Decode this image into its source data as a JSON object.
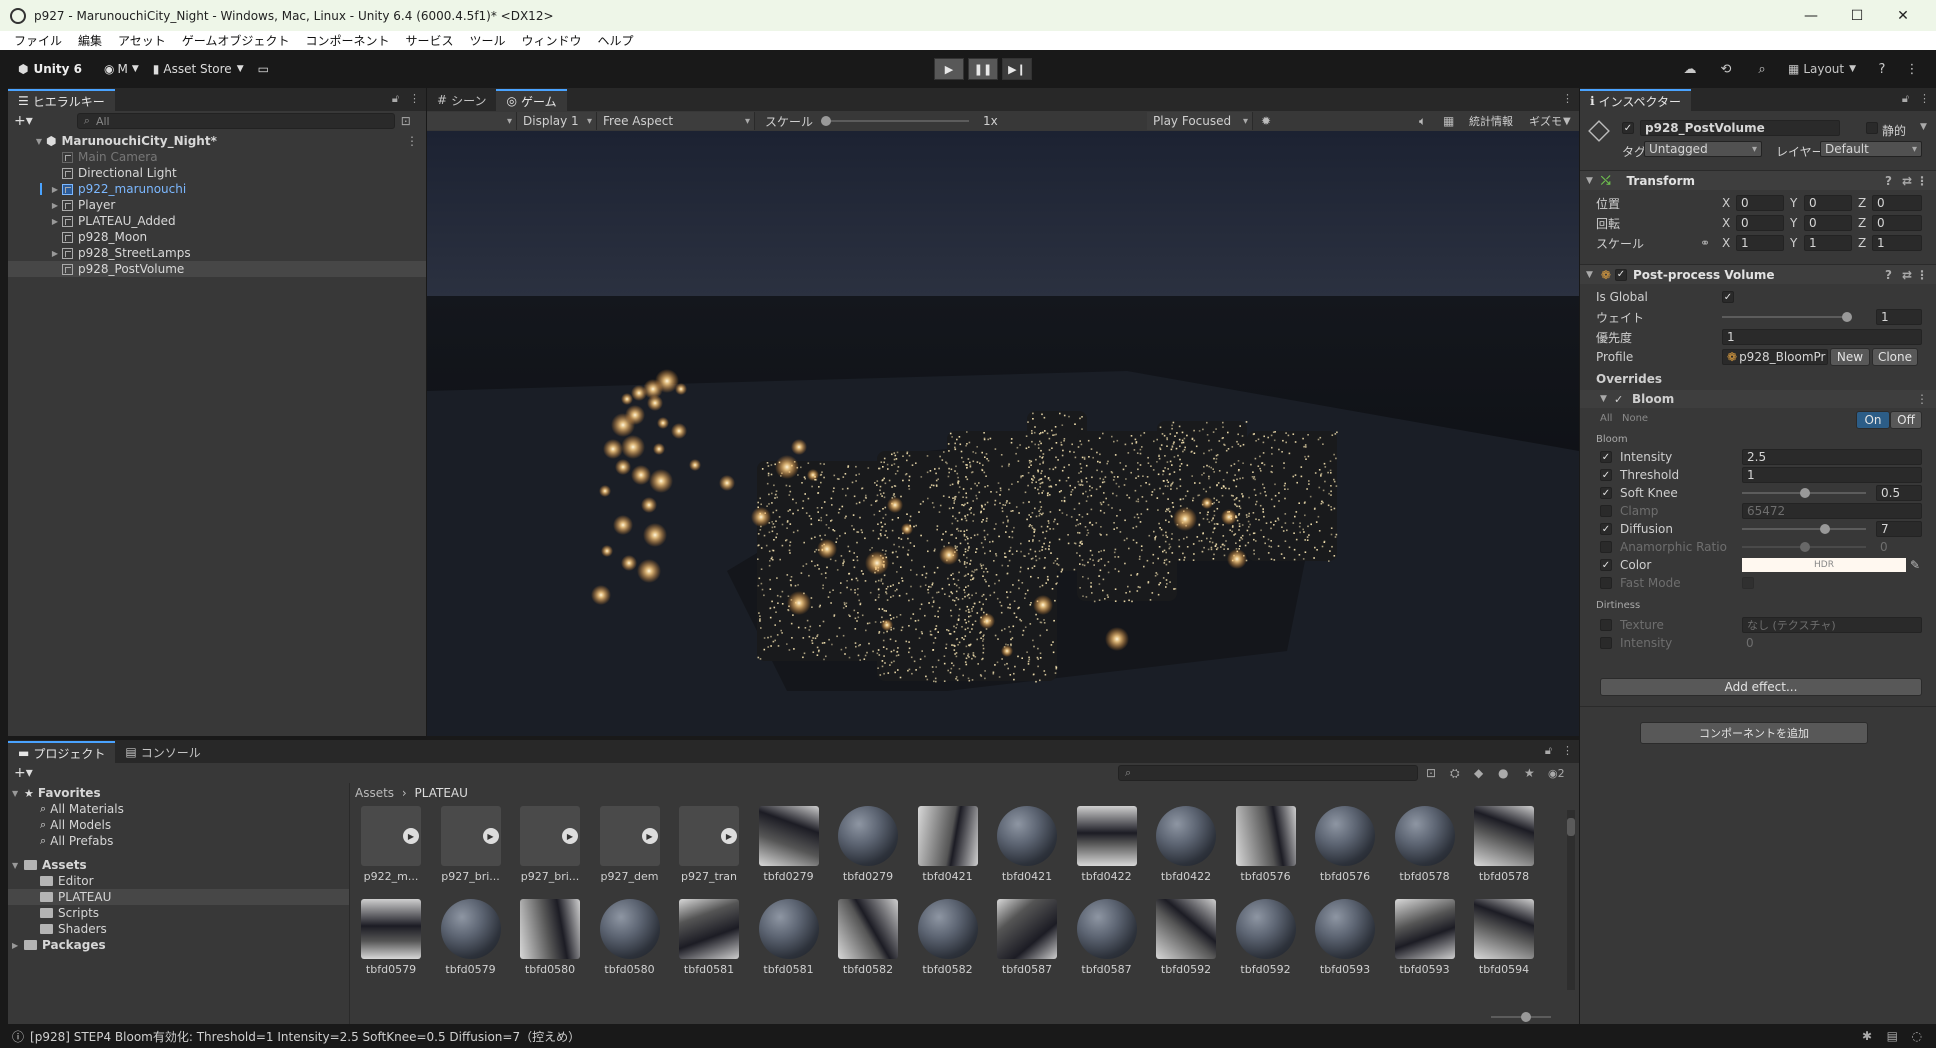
{
  "window": {
    "title": "p927 - MarunouchiCity_Night - Windows, Mac, Linux - Unity 6.4 (6000.4.5f1)* <DX12>",
    "minimize": "—",
    "maximize": "☐",
    "close": "✕"
  },
  "menu": [
    "ファイル",
    "編集",
    "アセット",
    "ゲームオブジェクト",
    "コンポーネント",
    "サービス",
    "ツール",
    "ウィンドウ",
    "ヘルプ"
  ],
  "toolbar": {
    "unity": "Unity 6",
    "account": "M",
    "asset_store": "Asset Store",
    "layout": "Layout"
  },
  "hierarchy": {
    "tab": "ヒエラルキー",
    "search_placeholder": "All",
    "scene": "MarunouchiCity_Night*",
    "items": [
      {
        "label": "Main Camera",
        "state": "dim",
        "expand": ""
      },
      {
        "label": "Directional Light",
        "state": "normal",
        "expand": ""
      },
      {
        "label": "p922_marunouchi",
        "state": "blue",
        "expand": "▶"
      },
      {
        "label": "Player",
        "state": "normal",
        "expand": "▶"
      },
      {
        "label": "PLATEAU_Added",
        "state": "normal",
        "expand": "▶"
      },
      {
        "label": "p928_Moon",
        "state": "normal",
        "expand": ""
      },
      {
        "label": "p928_StreetLamps",
        "state": "normal",
        "expand": "▶"
      },
      {
        "label": "p928_PostVolume",
        "state": "selected",
        "expand": ""
      }
    ]
  },
  "game": {
    "tab_scene": "シーン",
    "tab_game": "ゲーム",
    "display": "Display 1",
    "aspect": "Free Aspect",
    "scale_label": "スケール",
    "scale_value": "1x",
    "play_mode": "Play Focused",
    "stats": "統計情報",
    "gizmos": "ギズモ"
  },
  "inspector": {
    "tab": "インスペクター",
    "object_name": "p928_PostVolume",
    "static_label": "静的",
    "tag_label": "タグ",
    "tag": "Untagged",
    "layer_label": "レイヤー",
    "layer": "Default",
    "transform": {
      "title": "Transform",
      "rows": [
        {
          "label": "位置",
          "x": "0",
          "y": "0",
          "z": "0"
        },
        {
          "label": "回転",
          "x": "0",
          "y": "0",
          "z": "0"
        },
        {
          "label": "スケール",
          "x": "1",
          "y": "1",
          "z": "1"
        }
      ]
    },
    "ppv": {
      "title": "Post-process Volume",
      "is_global_label": "Is Global",
      "weight_label": "ウェイト",
      "weight": "1",
      "priority_label": "優先度",
      "priority": "1",
      "profile_label": "Profile",
      "profile": "p928_BloomPr",
      "new_btn": "New",
      "clone_btn": "Clone",
      "overrides": "Overrides",
      "bloom": "Bloom",
      "all": "All",
      "none": "None",
      "on": "On",
      "off": "Off",
      "bloom_section": "Bloom",
      "intensity_label": "Intensity",
      "intensity": "2.5",
      "threshold_label": "Threshold",
      "threshold": "1",
      "soft_knee_label": "Soft Knee",
      "soft_knee": "0.5",
      "clamp_label": "Clamp",
      "clamp": "65472",
      "diffusion_label": "Diffusion",
      "diffusion": "7",
      "anamorphic_label": "Anamorphic Ratio",
      "anamorphic": "0",
      "color_label": "Color",
      "color_hdr": "HDR",
      "fast_mode_label": "Fast Mode",
      "dirtiness": "Dirtiness",
      "texture_label": "Texture",
      "texture": "なし (テクスチャ)",
      "dirt_intensity_label": "Intensity",
      "dirt_intensity": "0",
      "add_effect": "Add effect...",
      "add_component": "コンポーネントを追加"
    }
  },
  "project": {
    "tab_project": "プロジェクト",
    "tab_console": "コンソール",
    "hidden_count": "2",
    "favorites": "Favorites",
    "fav_items": [
      "All Materials",
      "All Models",
      "All Prefabs"
    ],
    "assets": "Assets",
    "asset_folders": [
      "Editor",
      "PLATEAU",
      "Scripts",
      "Shaders"
    ],
    "packages": "Packages",
    "breadcrumb_root": "Assets",
    "breadcrumb_current": "PLATEAU",
    "row1": [
      {
        "label": "p922_m...",
        "kind": "model"
      },
      {
        "label": "p927_bri...",
        "kind": "model"
      },
      {
        "label": "p927_bri...",
        "kind": "model"
      },
      {
        "label": "p927_dem",
        "kind": "model"
      },
      {
        "label": "p927_tran",
        "kind": "model"
      },
      {
        "label": "tbfd0279",
        "kind": "tex"
      },
      {
        "label": "tbfd0279",
        "kind": "mat"
      },
      {
        "label": "tbfd0421",
        "kind": "tex"
      },
      {
        "label": "tbfd0421",
        "kind": "mat"
      },
      {
        "label": "tbfd0422",
        "kind": "tex"
      },
      {
        "label": "tbfd0422",
        "kind": "mat"
      },
      {
        "label": "tbfd0576",
        "kind": "tex"
      },
      {
        "label": "tbfd0576",
        "kind": "mat"
      },
      {
        "label": "tbfd0578",
        "kind": "mat"
      },
      {
        "label": "tbfd0578",
        "kind": "tex"
      }
    ],
    "row2": [
      {
        "label": "tbfd0579",
        "kind": "tex"
      },
      {
        "label": "tbfd0579",
        "kind": "mat"
      },
      {
        "label": "tbfd0580",
        "kind": "tex"
      },
      {
        "label": "tbfd0580",
        "kind": "mat"
      },
      {
        "label": "tbfd0581",
        "kind": "tex"
      },
      {
        "label": "tbfd0581",
        "kind": "mat"
      },
      {
        "label": "tbfd0582",
        "kind": "tex"
      },
      {
        "label": "tbfd0582",
        "kind": "mat"
      },
      {
        "label": "tbfd0587",
        "kind": "tex"
      },
      {
        "label": "tbfd0587",
        "kind": "mat"
      },
      {
        "label": "tbfd0592",
        "kind": "tex"
      },
      {
        "label": "tbfd0592",
        "kind": "mat"
      },
      {
        "label": "tbfd0593",
        "kind": "mat"
      },
      {
        "label": "tbfd0593",
        "kind": "tex"
      },
      {
        "label": "tbfd0594",
        "kind": "tex"
      }
    ]
  },
  "status": "[p928] STEP4 Bloom有効化: Threshold=1 Intensity=2.5 SoftKnee=0.5 Diffusion=7（控えめ）",
  "colors": {
    "accent": "#4aa3ff",
    "selected": "#2c5d87",
    "on_button": "#2c5d87",
    "light": "#ffd38a"
  }
}
